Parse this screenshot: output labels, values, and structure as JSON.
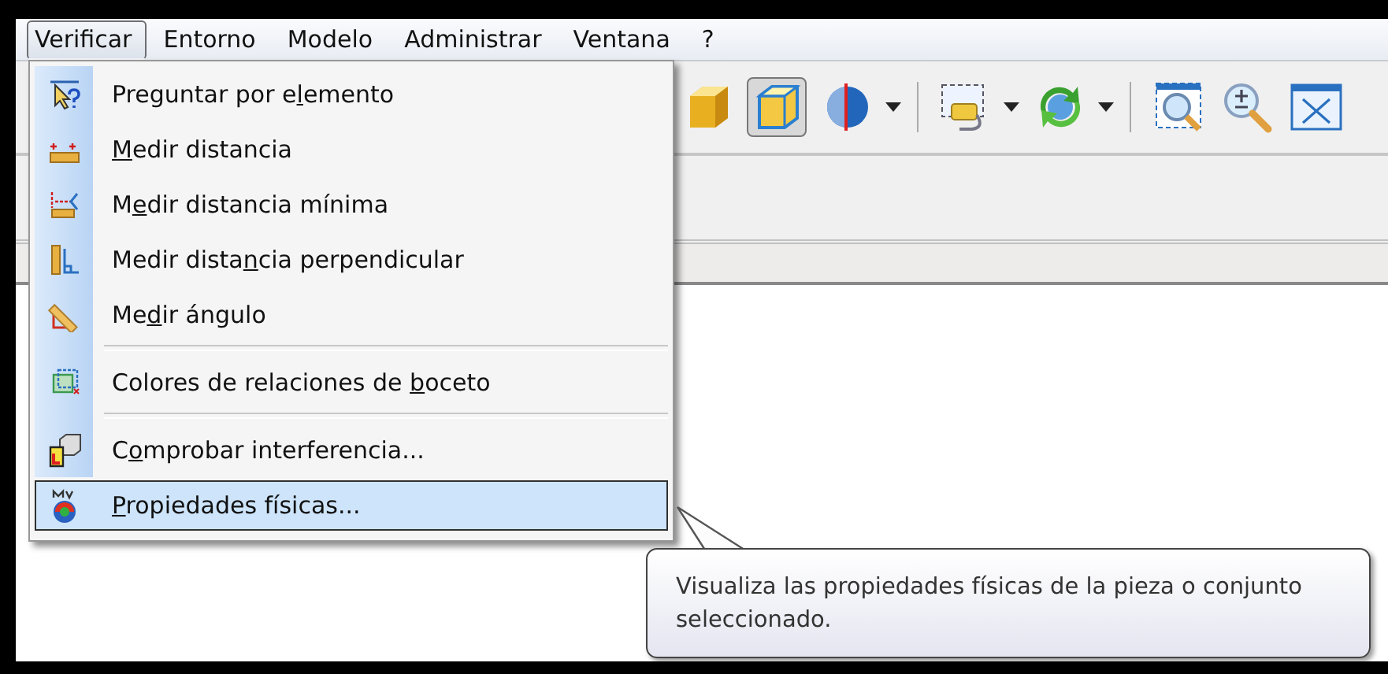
{
  "menu_bar": [
    {
      "label": "Verificar",
      "selected": true
    },
    {
      "label": "Entorno",
      "selected": false
    },
    {
      "label": "Modelo",
      "selected": false
    },
    {
      "label": "Administrar",
      "selected": false
    },
    {
      "label": "Ventana",
      "selected": false
    },
    {
      "label": "?",
      "selected": false
    }
  ],
  "toolbar": [
    {
      "kind": "cube",
      "pressed": false
    },
    {
      "kind": "box",
      "pressed": true
    },
    {
      "kind": "section",
      "pressed": false
    },
    {
      "kind": "dropdown"
    },
    {
      "kind": "separator"
    },
    {
      "kind": "tag",
      "pressed": false
    },
    {
      "kind": "dropdown"
    },
    {
      "kind": "rotate",
      "pressed": false
    },
    {
      "kind": "dropdown"
    },
    {
      "kind": "separator"
    },
    {
      "kind": "zoomarea",
      "pressed": false
    },
    {
      "kind": "zoom",
      "pressed": false
    },
    {
      "kind": "fit",
      "pressed": false
    }
  ],
  "menu": {
    "items": [
      {
        "kind": "item",
        "before": "Preguntar por e",
        "key": "l",
        "after": "emento",
        "selected": false
      },
      {
        "kind": "item",
        "key": "M",
        "after": "edir distancia",
        "selected": false
      },
      {
        "kind": "item",
        "before": "M",
        "key": "e",
        "after": "dir distancia mínima",
        "selected": false
      },
      {
        "kind": "item",
        "before": "Medir dista",
        "key": "n",
        "after": "cia perpendicular",
        "selected": false
      },
      {
        "kind": "item",
        "before": "Me",
        "key": "d",
        "after": "ir ángulo",
        "selected": false
      },
      {
        "kind": "separator"
      },
      {
        "kind": "item",
        "before": "Colores de relaciones de ",
        "key": "b",
        "after": "oceto",
        "selected": false
      },
      {
        "kind": "separator"
      },
      {
        "kind": "item",
        "before": "C",
        "key": "o",
        "after": "mprobar interferencia...",
        "selected": false
      },
      {
        "kind": "item",
        "key": "P",
        "after": "ropiedades físicas...",
        "selected": true
      }
    ]
  },
  "tooltip": {
    "text": "Visualiza las propiedades físicas de la pieza o conjunto seleccionado."
  }
}
